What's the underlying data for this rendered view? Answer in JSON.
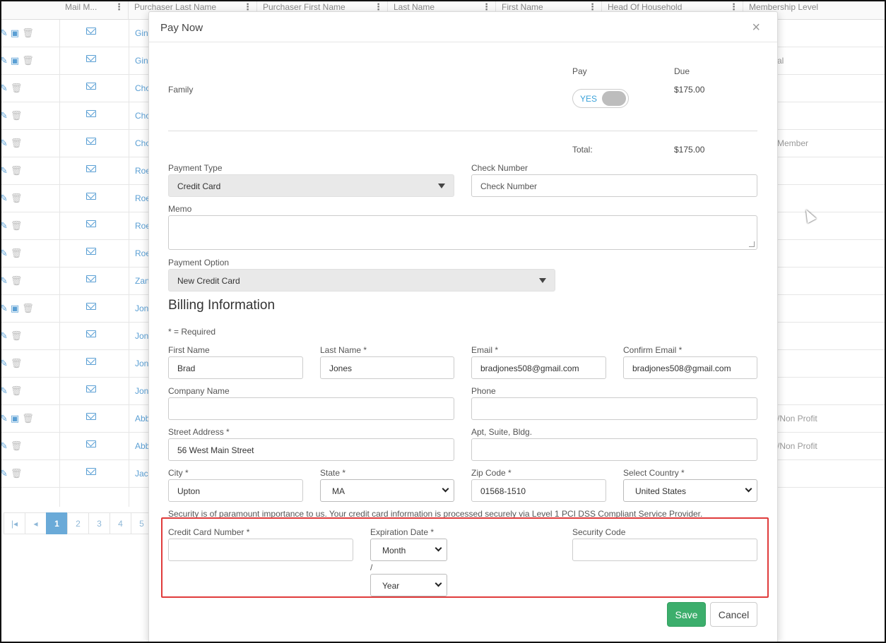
{
  "grid": {
    "columns": [
      "Mail M...",
      "Purchaser Last Name",
      "Purchaser First Name",
      "Last Name",
      "First Name",
      "Head Of Household",
      "Membership Level"
    ],
    "rows": [
      {
        "name": "Gin",
        "level": ""
      },
      {
        "name": "Gin",
        "level": "al"
      },
      {
        "name": "Cho",
        "level": ""
      },
      {
        "name": "Cho",
        "level": ""
      },
      {
        "name": "Cho",
        "level": "Member"
      },
      {
        "name": "Roe",
        "level": ""
      },
      {
        "name": "Roe",
        "level": ""
      },
      {
        "name": "Roe",
        "level": ""
      },
      {
        "name": "Roe",
        "level": ""
      },
      {
        "name": "Zan",
        "level": ""
      },
      {
        "name": "Jon",
        "level": ""
      },
      {
        "name": "Jon",
        "level": ""
      },
      {
        "name": "Jon",
        "level": ""
      },
      {
        "name": "Jon",
        "level": ""
      },
      {
        "name": "Abb",
        "level": "/Non Profit"
      },
      {
        "name": "Abb",
        "level": "/Non Profit"
      },
      {
        "name": "Jac",
        "level": ""
      }
    ],
    "pager": [
      "1",
      "2",
      "3",
      "4",
      "5"
    ]
  },
  "modal": {
    "title": "Pay Now",
    "close": "×",
    "pay_header": "Pay",
    "due_header": "Due",
    "family_label": "Family",
    "toggle_label": "YES",
    "family_due": "$175.00",
    "total_label": "Total:",
    "total_value": "$175.00",
    "payment_type_label": "Payment Type",
    "payment_type_value": "Credit Card",
    "check_number_label": "Check Number",
    "check_number_placeholder": "Check Number",
    "memo_label": "Memo",
    "payment_option_label": "Payment Option",
    "payment_option_value": "New Credit Card",
    "billing_title": "Billing Information",
    "required_note": "* = Required",
    "first_name_label": "First Name",
    "first_name_value": "Brad",
    "last_name_label": "Last Name *",
    "last_name_value": "Jones",
    "email_label": "Email *",
    "email_value": "bradjones508@gmail.com",
    "confirm_email_label": "Confirm Email *",
    "confirm_email_value": "bradjones508@gmail.com",
    "company_label": "Company Name",
    "phone_label": "Phone",
    "street_label": "Street Address *",
    "street_value": "56 West Main Street",
    "apt_label": "Apt, Suite, Bldg.",
    "city_label": "City *",
    "city_value": "Upton",
    "state_label": "State *",
    "state_value": "MA",
    "zip_label": "Zip Code *",
    "zip_value": "01568-1510",
    "country_label": "Select Country *",
    "country_value": "United States",
    "security_note": "Security is of paramount importance to us. Your credit card information is processed securely via Level 1 PCI DSS Compliant Service Provider.",
    "cc_number_label": "Credit Card Number *",
    "expiration_label": "Expiration Date *",
    "month_value": "Month",
    "slash": "/",
    "year_value": "Year",
    "security_code_label": "Security Code",
    "save_label": "Save",
    "cancel_label": "Cancel"
  },
  "colors": {
    "save": "#3cae6c",
    "highlight": "#e03b3b",
    "link": "#5a9fd4"
  }
}
